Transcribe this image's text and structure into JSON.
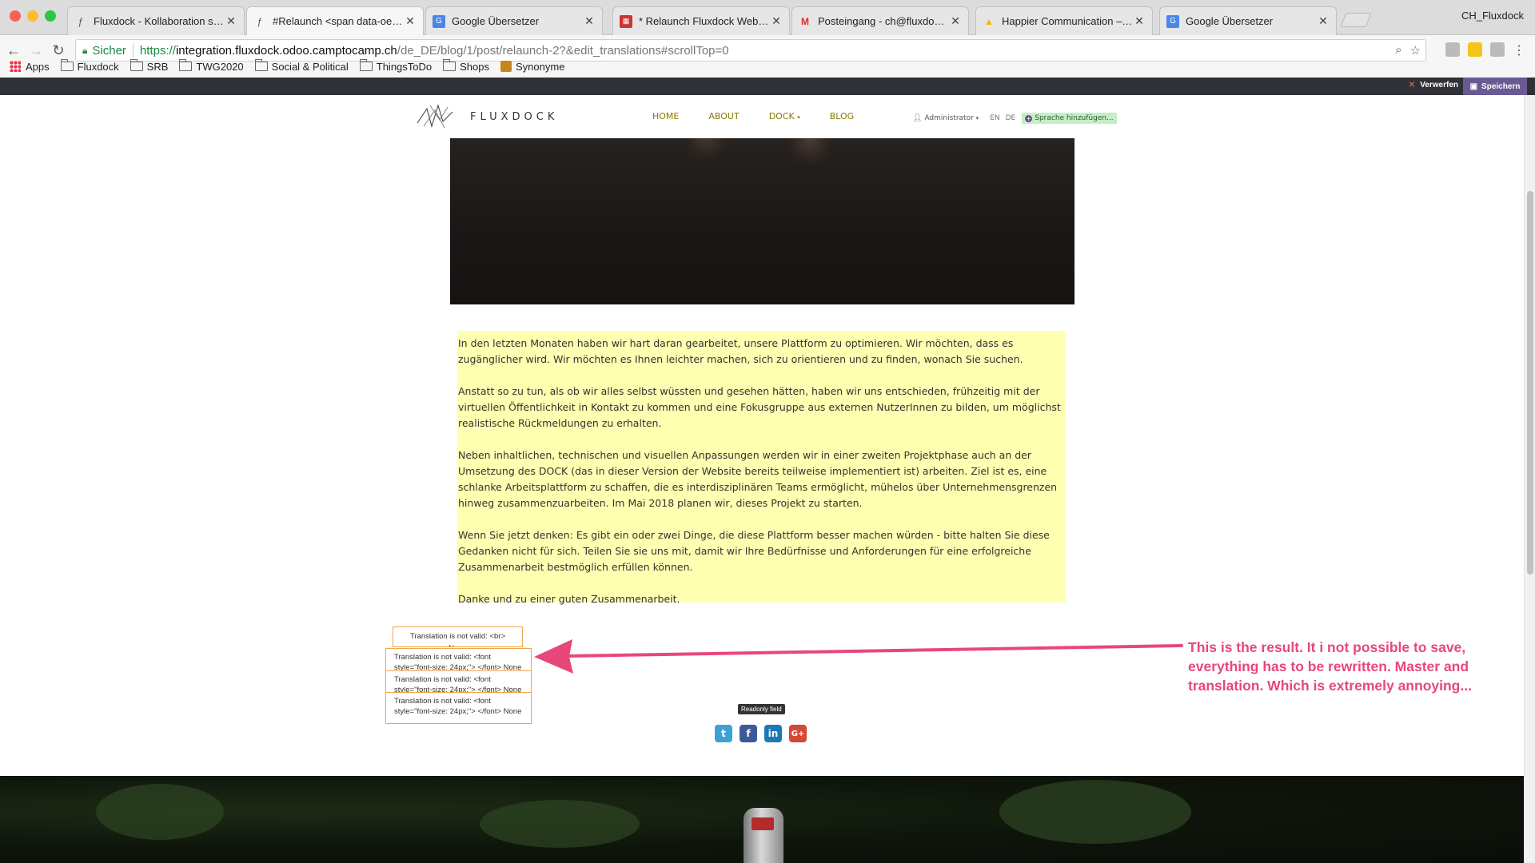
{
  "browser": {
    "tabs": [
      {
        "title": "Fluxdock - Kollaboration schaff",
        "icon": "fluxdock-icon"
      },
      {
        "title": "#Relaunch <span data-oe-mod",
        "icon": "fluxdock-icon"
      },
      {
        "title": "Google Übersetzer",
        "icon": "google-translate-icon"
      },
      {
        "title": "* Relaunch Fluxdock Website |",
        "icon": "doc-icon"
      },
      {
        "title": "Posteingang - ch@fluxdock.io",
        "icon": "gmail-icon"
      },
      {
        "title": "Happier Communication – Goo",
        "icon": "drive-icon"
      },
      {
        "title": "Google Übersetzer",
        "icon": "google-translate-icon"
      }
    ],
    "profile": "CH_Fluxdock",
    "address": {
      "secure_label": "Sicher",
      "scheme": "https://",
      "host": "integration.fluxdock.odoo.camptocamp.ch",
      "path": "/de_DE/blog/1/post/relaunch-2?&edit_translations#scrollTop=0"
    },
    "bookmarks": [
      "Apps",
      "Fluxdock",
      "SRB",
      "TWG2020",
      "Social & Political",
      "ThingsToDo",
      "Shops",
      "Synonyme"
    ]
  },
  "odoo_bar": {
    "discard_label": "Verwerfen",
    "save_label": "Speichern"
  },
  "site": {
    "logo_text": "FLUXDOCK",
    "nav": [
      "HOME",
      "ABOUT",
      "DOCK",
      "BLOG"
    ],
    "user": "Administrator",
    "langs": [
      "EN",
      "DE"
    ],
    "add_language": "Sprache hinzufügen..."
  },
  "article": {
    "paragraphs": [
      "In den letzten Monaten haben wir hart daran gearbeitet, unsere Plattform zu optimieren. Wir möchten, dass es zugänglicher wird. Wir möchten es Ihnen leichter machen, sich zu orientieren und zu finden, wonach Sie suchen.",
      "Anstatt so zu tun, als ob wir alles selbst wüssten und gesehen hätten, haben wir uns entschieden, frühzeitig mit der virtuellen Öffentlichkeit in Kontakt zu kommen und eine Fokusgruppe aus externen NutzerInnen zu bilden, um möglichst realistische Rückmeldungen zu erhalten.",
      "Neben inhaltlichen, technischen und visuellen Anpassungen werden wir in einer zweiten Projektphase auch an der Umsetzung des DOCK (das in dieser Version der Website bereits teilweise implementiert ist) arbeiten. Ziel ist es, eine schlanke Arbeitsplattform zu schaffen, die es interdisziplinären Teams ermöglicht, mühelos über Unternehmensgrenzen hinweg zusammenzuarbeiten. Im Mai 2018 planen wir, dieses Projekt zu starten.",
      "Wenn Sie jetzt denken: Es gibt ein oder zwei Dinge, die diese Plattform besser machen würden - bitte halten Sie diese Gedanken nicht für sich. Teilen Sie sie uns mit, damit wir Ihre Bedürfnisse und Anforderungen für eine erfolgreiche Zusammenarbeit bestmöglich erfüllen können.",
      "Danke und zu einer guten Zusammenarbeit."
    ]
  },
  "errors": [
    "Translation is not valid: <br> None",
    "Translation is not valid: <font style=\"font-size: 24px;\"> </font> None",
    "Translation is not valid: <font style=\"font-size: 24px;\"> </font> None",
    "Translation is not valid: <font style=\"font-size: 24px;\"> </font> None"
  ],
  "readonly_tooltip": "Readonly field",
  "share": {
    "twitter": "t",
    "facebook": "f",
    "linkedin": "in",
    "googleplus": "G+"
  },
  "annotation": "This is the result. It i not possible to save, everything has to be rewritten. Master and translation. Which is extremely annoying...",
  "colors": {
    "annotation": "#e8477a",
    "highlight": "#ffffb1",
    "nav": "#8a7a00",
    "tooltip_border": "#f0a54a"
  }
}
